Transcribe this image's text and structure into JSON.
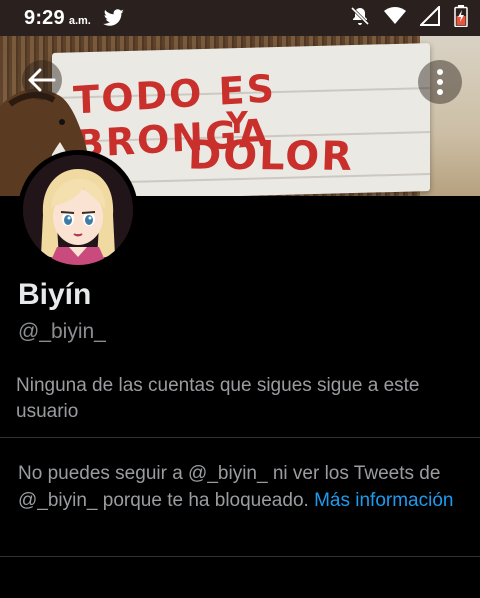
{
  "status_bar": {
    "time": "9:29",
    "ampm": "a.m.",
    "notification_icon": "twitter-bird-icon",
    "icons": [
      "bell-muted-icon",
      "wifi-icon",
      "signal-icon",
      "battery-charging-icon"
    ]
  },
  "banner": {
    "sign_lines": [
      "TODO ES BRONGA",
      "Y",
      "DOLOR"
    ]
  },
  "profile": {
    "display_name": "Biyín",
    "handle": "@_biyin_",
    "follow_note": "Ninguna de las cuentas que sigues sigue a este usuario",
    "blocked_message": "No puedes seguir a @_biyin_ ni ver los Tweets de @_biyin_ porque te ha bloqueado.",
    "more_info_link": "Más información"
  },
  "colors": {
    "background": "#000000",
    "status_bar": "#2a211e",
    "link": "#1d9bf0",
    "secondary_text": "#9a9c9f"
  }
}
